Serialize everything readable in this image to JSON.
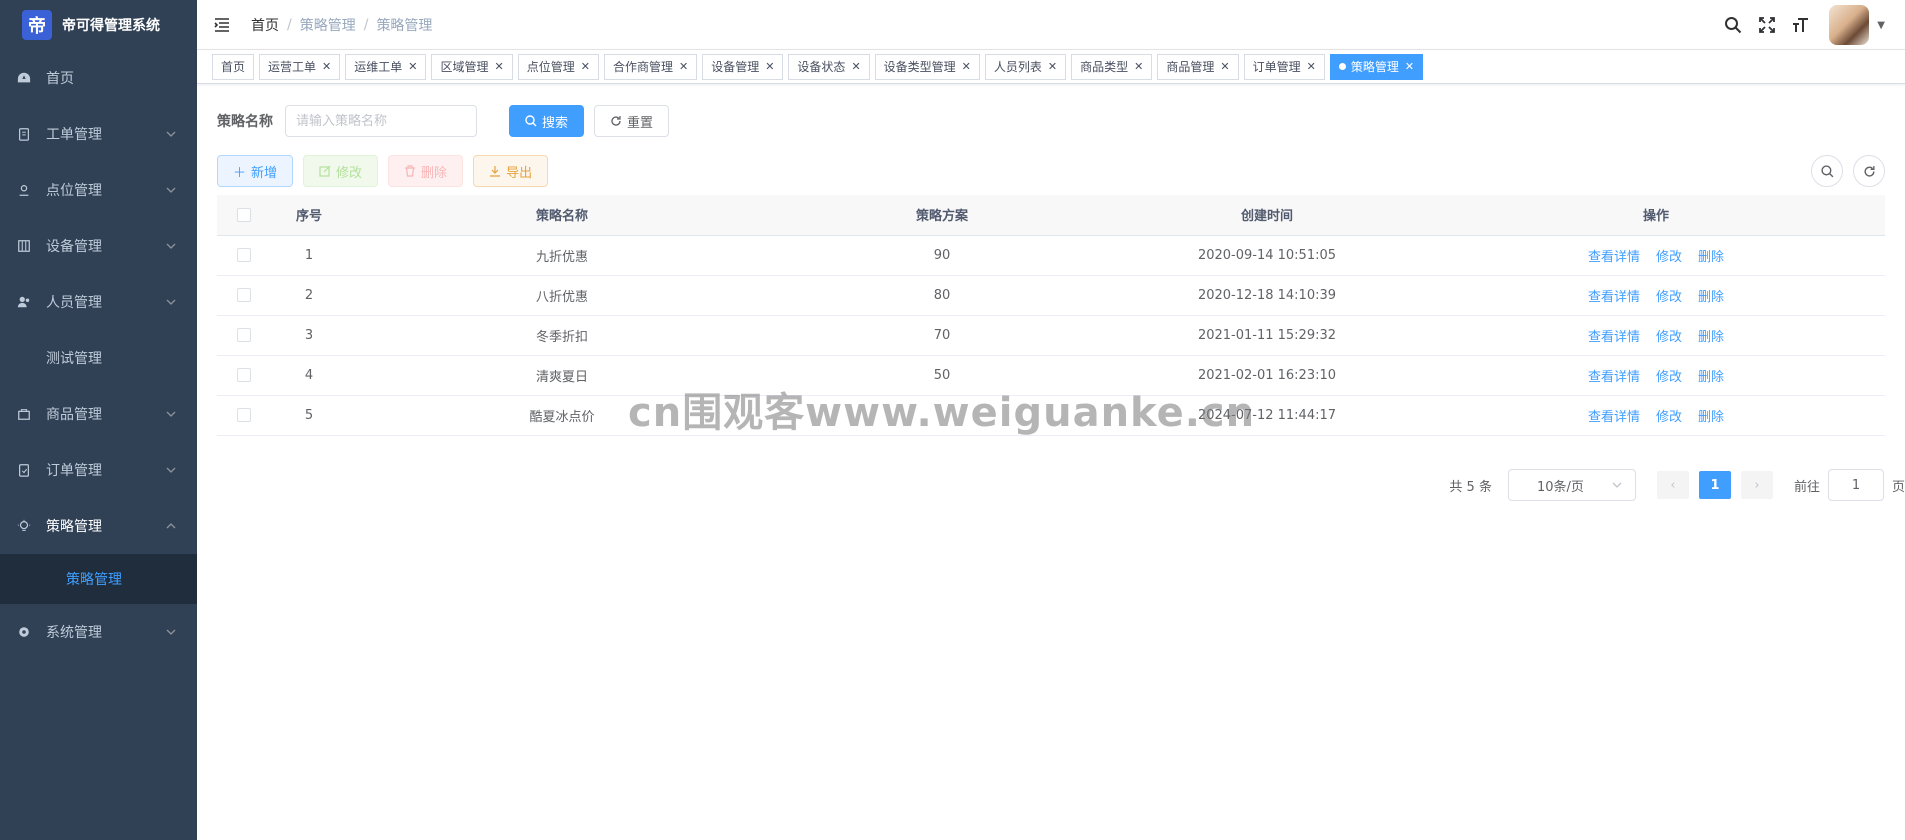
{
  "app": {
    "title": "帝可得管理系统",
    "logo_glyph": "帝"
  },
  "sidebar": {
    "items": [
      {
        "label": "首页",
        "icon": "dashboard-icon"
      },
      {
        "label": "工单管理",
        "icon": "clipboard-icon"
      },
      {
        "label": "点位管理",
        "icon": "location-pin-icon"
      },
      {
        "label": "设备管理",
        "icon": "device-icon"
      },
      {
        "label": "人员管理",
        "icon": "people-icon"
      },
      {
        "label": "测试管理",
        "icon": ""
      },
      {
        "label": "商品管理",
        "icon": "shopping-bag-icon"
      },
      {
        "label": "订单管理",
        "icon": "order-icon"
      },
      {
        "label": "策略管理",
        "icon": "lightbulb-icon"
      },
      {
        "label": "系统管理",
        "icon": "gear-icon"
      }
    ],
    "sub_active": "策略管理"
  },
  "breadcrumb": [
    "首页",
    "策略管理",
    "策略管理"
  ],
  "tags": [
    "首页",
    "运营工单",
    "运维工单",
    "区域管理",
    "点位管理",
    "合作商管理",
    "设备管理",
    "设备状态",
    "设备类型管理",
    "人员列表",
    "商品类型",
    "商品管理",
    "订单管理",
    "策略管理"
  ],
  "search": {
    "label": "策略名称",
    "placeholder": "请输入策略名称",
    "search_btn": "搜索",
    "reset_btn": "重置"
  },
  "toolbar": {
    "add": "新增",
    "edit": "修改",
    "delete": "删除",
    "export": "导出"
  },
  "table": {
    "headers": [
      "序号",
      "策略名称",
      "策略方案",
      "创建时间",
      "操作"
    ],
    "rows": [
      {
        "no": "1",
        "name": "九折优惠",
        "plan": "90",
        "time": "2020-09-14 10:51:05"
      },
      {
        "no": "2",
        "name": "八折优惠",
        "plan": "80",
        "time": "2020-12-18 14:10:39"
      },
      {
        "no": "3",
        "name": "冬季折扣",
        "plan": "70",
        "time": "2021-01-11 15:29:32"
      },
      {
        "no": "4",
        "name": "清爽夏日",
        "plan": "50",
        "time": "2021-02-01 16:23:10"
      },
      {
        "no": "5",
        "name": "酷夏冰点价",
        "plan": "",
        "time": "2024-07-12 11:44:17"
      }
    ],
    "ops": {
      "detail": "查看详情",
      "edit": "修改",
      "delete": "删除"
    }
  },
  "pagination": {
    "total": "共 5 条",
    "page_size": "10条/页",
    "current": "1",
    "goto_prefix": "前往",
    "goto_value": "1",
    "goto_suffix": "页"
  },
  "watermark": "cn围观客www.weiguanke.cn"
}
